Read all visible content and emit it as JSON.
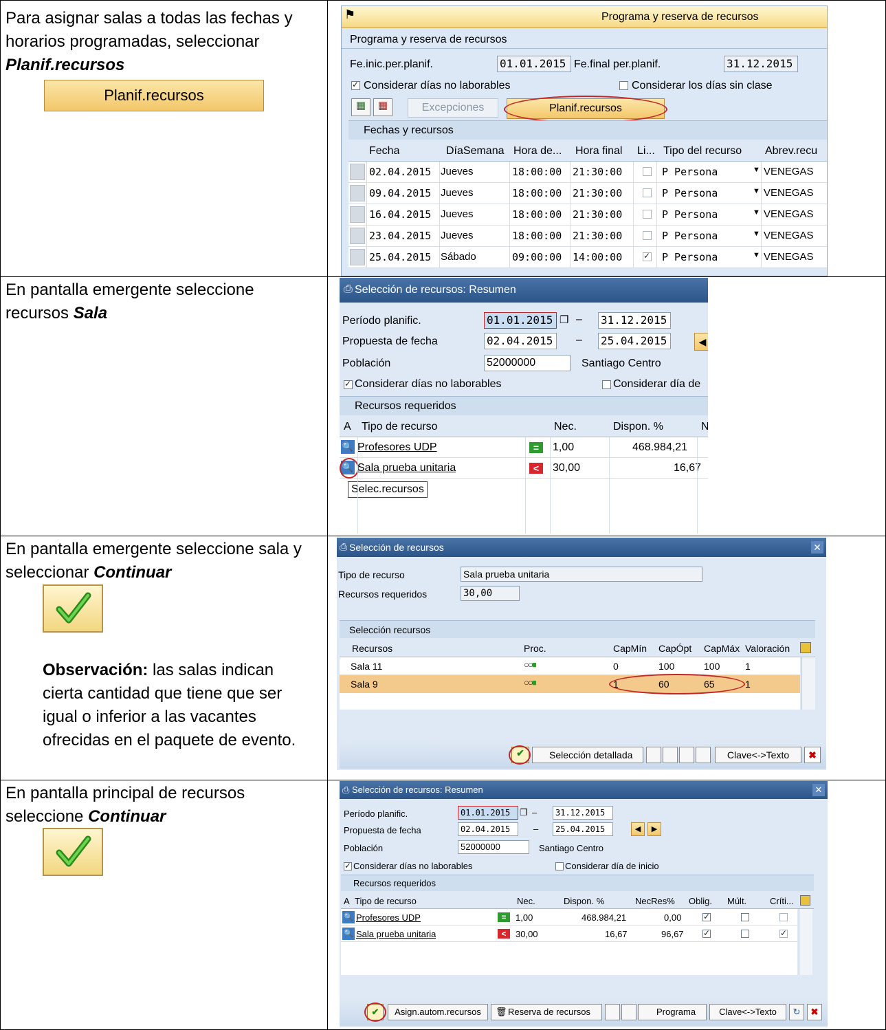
{
  "rows": [
    {
      "text": [
        "Para asignar salas a todas las fechas y horarios programadas, seleccionar "
      ],
      "emph": "Planif.recursos",
      "button_label": "Planif.recursos",
      "shot": {
        "app_title": "Programa y reserva de recursos",
        "section_title": "Programa y reserva de recursos",
        "start_label": "Fe.inic.per.planif.",
        "start_value": "01.01.2015",
        "end_label": "Fe.final per.planif.",
        "end_value": "31.12.2015",
        "cb1_label": "Considerar días no laborables",
        "cb2_label": "Considerar los días sin clase",
        "btn_exceptions": "Excepciones",
        "btn_planif": "Planif.recursos",
        "table_title": "Fechas y recursos",
        "columns": [
          "Fecha",
          "DíaSemana",
          "Hora de...",
          "Hora final",
          "Li...",
          "Tipo del recurso",
          "Abrev.recu"
        ],
        "table_rows": [
          {
            "fecha": "02.04.2015",
            "dia": "Jueves",
            "hi": "18:00:00",
            "hf": "21:30:00",
            "li": false,
            "tipo": "P Persona",
            "abrev": "VENEGAS"
          },
          {
            "fecha": "09.04.2015",
            "dia": "Jueves",
            "hi": "18:00:00",
            "hf": "21:30:00",
            "li": false,
            "tipo": "P Persona",
            "abrev": "VENEGAS"
          },
          {
            "fecha": "16.04.2015",
            "dia": "Jueves",
            "hi": "18:00:00",
            "hf": "21:30:00",
            "li": false,
            "tipo": "P Persona",
            "abrev": "VENEGAS"
          },
          {
            "fecha": "23.04.2015",
            "dia": "Jueves",
            "hi": "18:00:00",
            "hf": "21:30:00",
            "li": false,
            "tipo": "P Persona",
            "abrev": "VENEGAS"
          },
          {
            "fecha": "25.04.2015",
            "dia": "Sábado",
            "hi": "09:00:00",
            "hf": "14:00:00",
            "li": true,
            "tipo": "P Persona",
            "abrev": "VENEGAS"
          }
        ]
      }
    },
    {
      "text": "En pantalla emergente seleccione recursos ",
      "emph": "Sala",
      "shot": {
        "title": "Selección de recursos: Resumen",
        "period_label": "Período planific.",
        "period_from": "01.01.2015",
        "period_to": "31.12.2015",
        "proposal_label": "Propuesta de fecha",
        "proposal_from": "02.04.2015",
        "proposal_to": "25.04.2015",
        "population_label": "Población",
        "population_value": "52000000",
        "population_name": "Santiago Centro",
        "cb1_label": "Considerar días no laborables",
        "cb2_label": "Considerar día de",
        "section": "Recursos requeridos",
        "columns": [
          "A",
          "Tipo de recurso",
          "Nec.",
          "Dispon. %",
          "N"
        ],
        "items": [
          {
            "name": "Profesores UDP",
            "status": "=",
            "nec": "1,00",
            "disp": "468.984,21"
          },
          {
            "name": "Sala prueba unitaria",
            "status": "<",
            "nec": "30,00",
            "disp": "16,67"
          }
        ],
        "tooltip": "Selec.recursos"
      }
    },
    {
      "text": "En pantalla emergente seleccione sala y seleccionar ",
      "emph": "Continuar",
      "obs_label": "Observación:",
      "obs_text": " las salas indican cierta cantidad que tiene que ser igual o inferior a las vacantes ofrecidas en el paquete de evento.",
      "shot": {
        "title": "Selección de recursos",
        "type_label": "Tipo de recurso",
        "type_value": "Sala prueba unitaria",
        "req_label": "Recursos requeridos",
        "req_value": "30,00",
        "section": "Selección recursos",
        "columns": [
          "Recursos",
          "Proc.",
          "CapMín",
          "CapÓpt",
          "CapMáx",
          "Valoración"
        ],
        "items": [
          {
            "name": "Sala 11",
            "min": "0",
            "opt": "100",
            "max": "100",
            "val": "1"
          },
          {
            "name": "Sala 9",
            "min": "1",
            "opt": "60",
            "max": "65",
            "val": "1"
          }
        ],
        "btn_detail": "Selección detallada",
        "btn_key": "Clave<->Texto"
      }
    },
    {
      "text": "En pantalla principal de recursos seleccione ",
      "emph": "Continuar",
      "shot": {
        "title": "Selección de recursos: Resumen",
        "period_label": "Período planific.",
        "period_from": "01.01.2015",
        "period_to": "31.12.2015",
        "proposal_label": "Propuesta de fecha",
        "proposal_from": "02.04.2015",
        "proposal_to": "25.04.2015",
        "population_label": "Población",
        "population_value": "52000000",
        "population_name": "Santiago Centro",
        "cb1_label": "Considerar días no laborables",
        "cb2_label": "Considerar día de inicio",
        "section": "Recursos requeridos",
        "columns": [
          "A",
          "Tipo de recurso",
          "Nec.",
          "Dispon. %",
          "NecRes%",
          "Oblig.",
          "Múlt.",
          "Críti..."
        ],
        "items": [
          {
            "name": "Profesores UDP",
            "status": "=",
            "nec": "1,00",
            "disp": "468.984,21",
            "necres": "0,00",
            "oblig": true,
            "mult": false,
            "crit": false
          },
          {
            "name": "Sala prueba unitaria",
            "status": "<",
            "nec": "30,00",
            "disp": "16,67",
            "necres": "96,67",
            "oblig": true,
            "mult": false,
            "crit": true
          }
        ],
        "btn_auto": "Asign.autom.recursos",
        "btn_reserve": "Reserva de recursos",
        "btn_program": "Programa",
        "btn_key": "Clave<->Texto"
      }
    }
  ],
  "colors": {
    "sap_blue": "#2b5589",
    "highlight": "#c0262a",
    "button_gold": "#f3c76a"
  }
}
